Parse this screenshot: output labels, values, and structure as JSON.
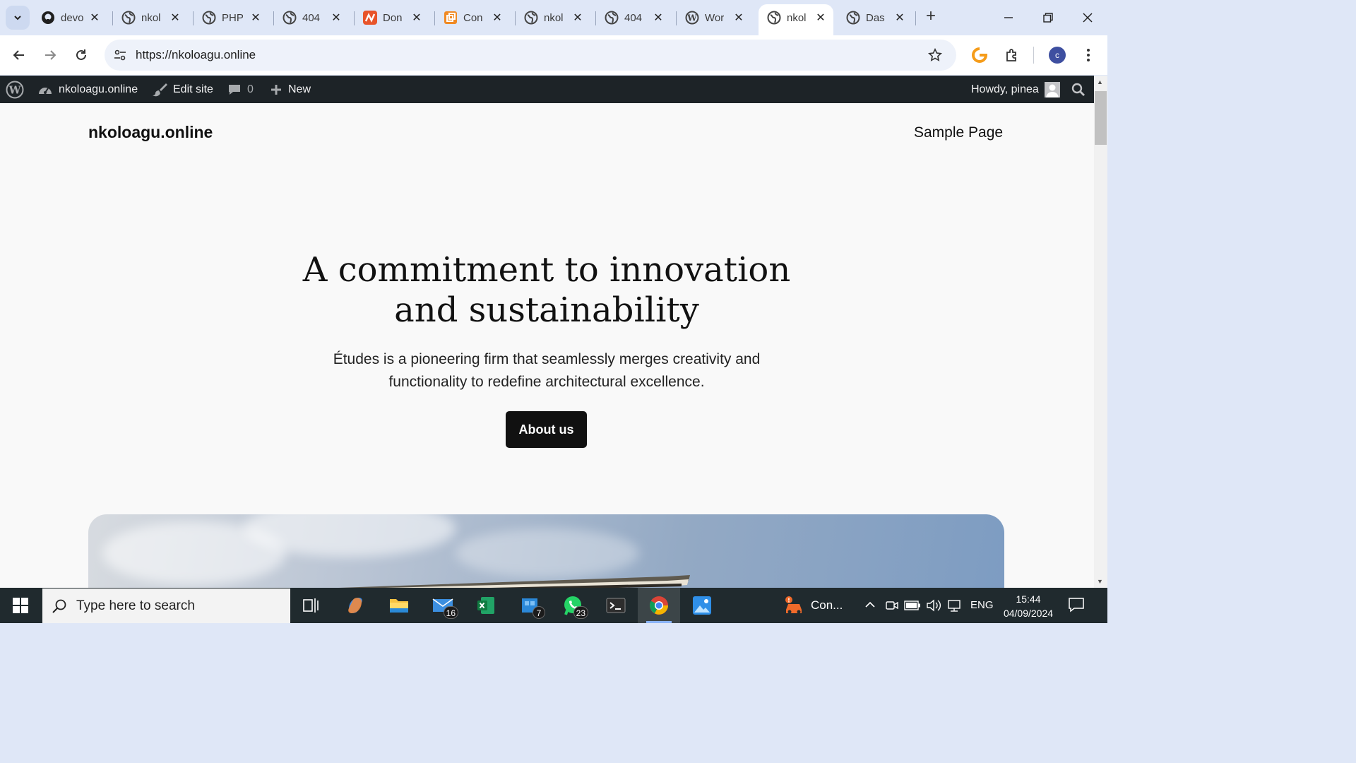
{
  "browser": {
    "tabs": [
      {
        "title": "devo",
        "icon": "github-icon"
      },
      {
        "title": "nkol",
        "icon": "globe-icon"
      },
      {
        "title": "PHP",
        "icon": "globe-icon"
      },
      {
        "title": "404",
        "icon": "globe-icon"
      },
      {
        "title": "Don",
        "icon": "orange-n-icon"
      },
      {
        "title": "Con",
        "icon": "orange-copy-icon"
      },
      {
        "title": "nkol",
        "icon": "globe-icon"
      },
      {
        "title": "404",
        "icon": "globe-icon"
      },
      {
        "title": "Wor",
        "icon": "wordpress-icon"
      },
      {
        "title": "nkol",
        "icon": "globe-icon",
        "active": true
      },
      {
        "title": "Das",
        "icon": "globe-icon"
      }
    ],
    "url": "https://nkoloagu.online",
    "profile_initial": "c"
  },
  "adminbar": {
    "site_name": "nkoloagu.online",
    "edit_site": "Edit site",
    "comments_count": "0",
    "new_label": "New",
    "howdy": "Howdy, pinea"
  },
  "site": {
    "title": "nkoloagu.online",
    "nav_link": "Sample Page",
    "hero_heading_line1": "A commitment to innovation",
    "hero_heading_line2": "and sustainability",
    "hero_sub_line1": "Études is a pioneering firm that seamlessly merges creativity and",
    "hero_sub_line2": "functionality to redefine architectural excellence.",
    "cta_label": "About us"
  },
  "taskbar": {
    "search_placeholder": "Type here to search",
    "mail_badge": "16",
    "store_badge": "7",
    "whatsapp_badge": "23",
    "notification_text": "Con...",
    "language": "ENG",
    "time": "15:44",
    "date": "04/09/2024"
  },
  "colors": {
    "adminbar_bg": "#1d2327",
    "page_bg": "#f9f9f9",
    "cta_bg": "#111111",
    "tabstrip_bg": "#dfe7f7",
    "taskbar_bg": "#202a2e"
  }
}
